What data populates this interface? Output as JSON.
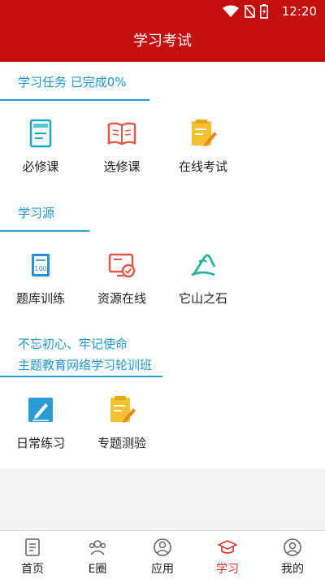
{
  "status_bar": {
    "time": "12:20"
  },
  "app_bar": {
    "title": "学习考试"
  },
  "sections": {
    "tasks": {
      "title": "学习任务  已完成0%",
      "items": [
        {
          "label": "必修课",
          "icon": "book-icon"
        },
        {
          "label": "选修课",
          "icon": "open-book-icon"
        },
        {
          "label": "在线考试",
          "icon": "exam-edit-icon"
        }
      ]
    },
    "source": {
      "title": "学习源",
      "items": [
        {
          "label": "题库训练",
          "icon": "question-bank-icon"
        },
        {
          "label": "资源在线",
          "icon": "monitor-check-icon"
        },
        {
          "label": "它山之石",
          "icon": "stone-icon"
        }
      ]
    },
    "training": {
      "title_line1": "不忘初心、牢记使命",
      "title_line2": "主题教育网络学习轮训班",
      "items": [
        {
          "label": "日常练习",
          "icon": "pencil-box-icon"
        },
        {
          "label": "专题测验",
          "icon": "test-paper-icon"
        }
      ]
    }
  },
  "tab_bar": {
    "active": "学习",
    "tabs": [
      {
        "label": "首页",
        "icon": "home-doc-icon"
      },
      {
        "label": "E圈",
        "icon": "group-icon"
      },
      {
        "label": "应用",
        "icon": "apps-person-icon"
      },
      {
        "label": "学习",
        "icon": "graduation-cap-icon"
      },
      {
        "label": "我的",
        "icon": "profile-icon"
      }
    ]
  },
  "colors": {
    "brand_red": "#c40f0f",
    "section_blue": "#2196c8",
    "active_tab": "#d33333"
  }
}
